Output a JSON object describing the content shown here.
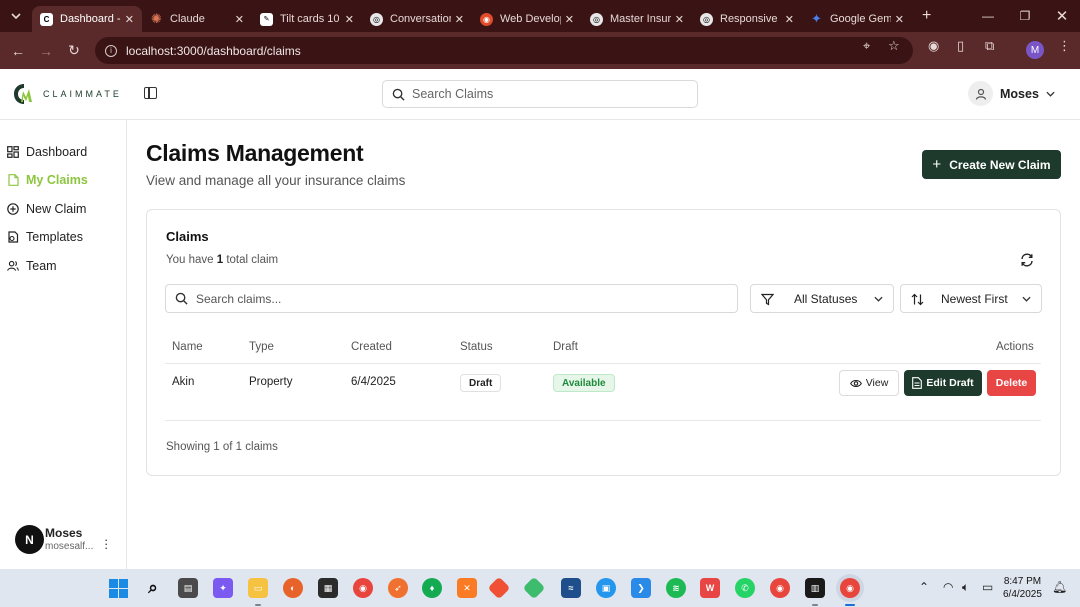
{
  "browser": {
    "tabs": [
      {
        "label": "Dashboard -",
        "active": true,
        "favicon": "claimmate-favicon",
        "color": "#ffffff"
      },
      {
        "label": "Claude",
        "favicon": "claude-favicon",
        "color": "#d97757"
      },
      {
        "label": "Tilt cards 10",
        "favicon": "codepen-favicon",
        "color": "#ffffff"
      },
      {
        "label": "Conversation",
        "favicon": "openai-favicon",
        "color": "#e8e8e8"
      },
      {
        "label": "Web Develop",
        "favicon": "web-favicon",
        "color": "#e04b2a"
      },
      {
        "label": "Master Insur",
        "favicon": "openai-favicon",
        "color": "#e8e8e8"
      },
      {
        "label": "Responsive",
        "favicon": "openai-favicon",
        "color": "#e8e8e8"
      },
      {
        "label": "Google Gem",
        "favicon": "gemini-favicon",
        "color": "#4a7df0"
      }
    ],
    "url": "localhost:3000/dashboard/claims",
    "profile_initial": "M"
  },
  "app": {
    "brand": "CLAIMMATE",
    "search_placeholder": "Search Claims",
    "user_name": "Moses"
  },
  "sidebar": {
    "items": [
      {
        "label": "Dashboard",
        "icon": "grid-icon",
        "active": false
      },
      {
        "label": "My Claims",
        "icon": "file-icon",
        "active": true
      },
      {
        "label": "New Claim",
        "icon": "plus-circle-icon",
        "active": false
      },
      {
        "label": "Templates",
        "icon": "template-icon",
        "active": false
      },
      {
        "label": "Team",
        "icon": "users-icon",
        "active": false
      }
    ],
    "user": {
      "initial": "N",
      "name": "Moses",
      "email": "mosesalf..."
    }
  },
  "main": {
    "title": "Claims Management",
    "subtitle": "View and manage all your insurance claims",
    "create_button": "Create New Claim",
    "card": {
      "title": "Claims",
      "desc_prefix": "You have ",
      "desc_count": "1",
      "desc_suffix": " total claim",
      "search_placeholder": "Search claims...",
      "status_filter": "All Statuses",
      "sort": "Newest First",
      "columns": [
        "Name",
        "Type",
        "Created",
        "Status",
        "Draft",
        "Actions"
      ],
      "rows": [
        {
          "name": "Akin",
          "type": "Property",
          "created": "6/4/2025",
          "status": "Draft",
          "draft": "Available"
        }
      ],
      "actions": {
        "view": "View",
        "edit": "Edit Draft",
        "delete": "Delete"
      },
      "footer": "Showing 1 of 1 claims"
    }
  },
  "taskbar": {
    "time": "8:47 PM",
    "date": "6/4/2025"
  },
  "colors": {
    "brand_dark": "#1e3a2c",
    "active_nav": "#8cc63f",
    "danger": "#e84545",
    "available_text": "#1f8a3a"
  }
}
